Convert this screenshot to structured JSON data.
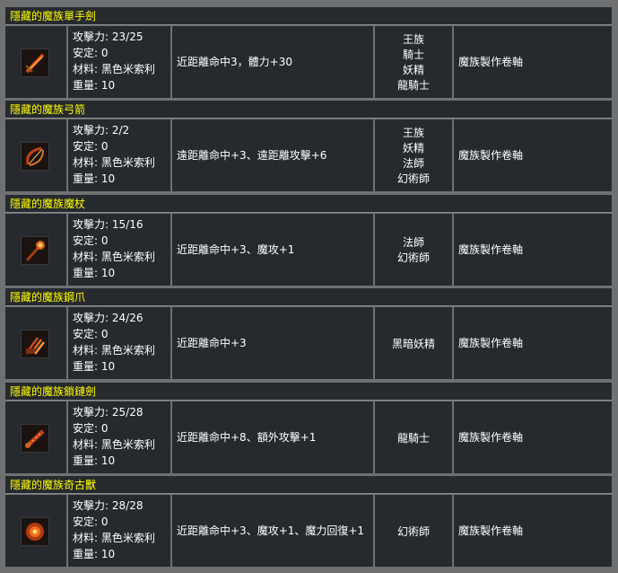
{
  "labels": {
    "attack": "攻擊力:",
    "safety": "安定:",
    "material": "材料:",
    "weight": "重量:"
  },
  "items": [
    {
      "name": "隱藏的魔族單手劍",
      "icon": "one-hand-sword-icon",
      "attack": "23/25",
      "safety": "0",
      "material": "黑色米索利",
      "weight": "10",
      "effect": "近距離命中3，體力+30",
      "classes": [
        "王族",
        "騎士",
        "妖精",
        "龍騎士"
      ],
      "source": "魔族製作卷軸"
    },
    {
      "name": "隱藏的魔族弓箭",
      "icon": "bow-icon",
      "attack": "2/2",
      "safety": "0",
      "material": "黑色米索利",
      "weight": "10",
      "effect": "遠距離命中+3、遠距離攻擊+6",
      "classes": [
        "王族",
        "妖精",
        "法師",
        "幻術師"
      ],
      "source": "魔族製作卷軸"
    },
    {
      "name": "隱藏的魔族魔杖",
      "icon": "staff-icon",
      "attack": "15/16",
      "safety": "0",
      "material": "黑色米索利",
      "weight": "10",
      "effect": "近距離命中+3、魔攻+1",
      "classes": [
        "法師",
        "幻術師"
      ],
      "source": "魔族製作卷軸"
    },
    {
      "name": "隱藏的魔族鋼爪",
      "icon": "claw-icon",
      "attack": "24/26",
      "safety": "0",
      "material": "黑色米索利",
      "weight": "10",
      "effect": "近距離命中+3",
      "classes": [
        "黑暗妖精"
      ],
      "source": "魔族製作卷軸"
    },
    {
      "name": "隱藏的魔族鎖鏈劍",
      "icon": "chain-sword-icon",
      "attack": "25/28",
      "safety": "0",
      "material": "黑色米索利",
      "weight": "10",
      "effect": "近距離命中+8、額外攻擊+1",
      "classes": [
        "龍騎士"
      ],
      "source": "魔族製作卷軸"
    },
    {
      "name": "隱藏的魔族奇古獸",
      "icon": "kiringku-icon",
      "attack": "28/28",
      "safety": "0",
      "material": "黑色米索利",
      "weight": "10",
      "effect": "近距離命中+3、魔攻+1、魔力回復+1",
      "classes": [
        "幻術師"
      ],
      "source": "魔族製作卷軸"
    }
  ]
}
